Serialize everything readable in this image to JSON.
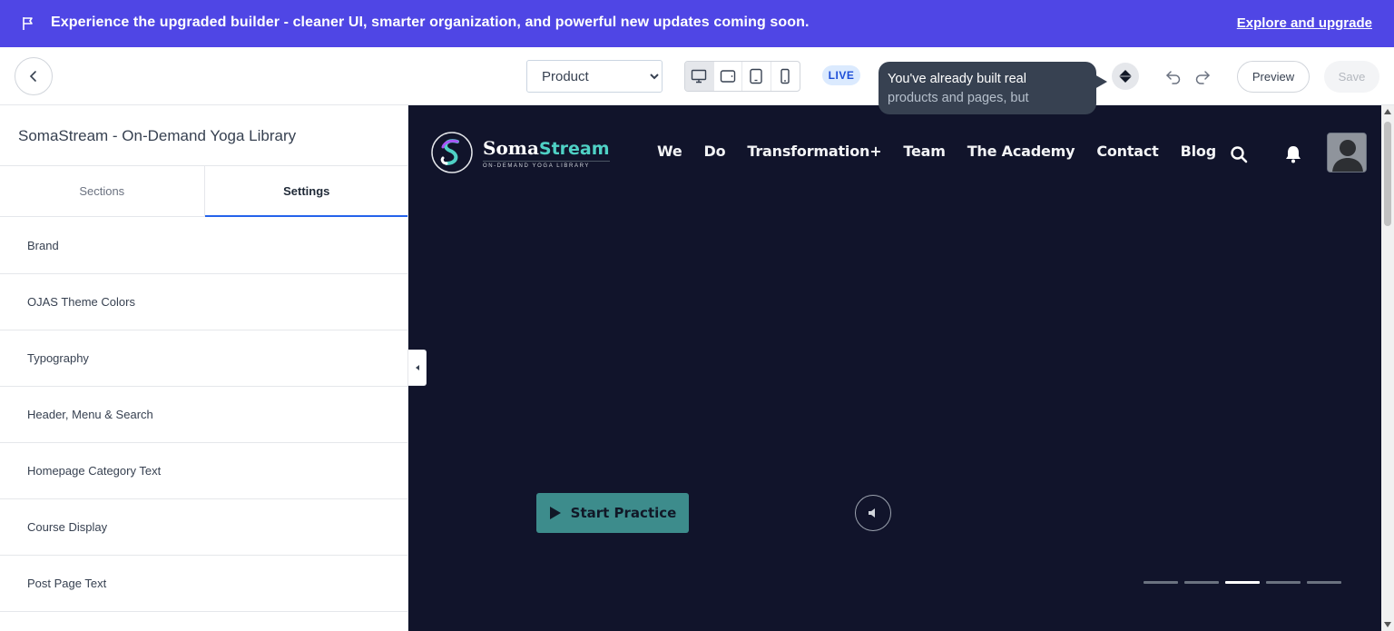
{
  "banner": {
    "message": "Experience the upgraded builder - cleaner UI, smarter organization, and powerful new updates coming soon.",
    "link": "Explore and upgrade"
  },
  "toolbar": {
    "page_select": {
      "selected": "Product",
      "options": [
        "Product"
      ]
    },
    "devices": [
      "desktop-icon",
      "tablet-landscape-icon",
      "tablet-portrait-icon",
      "mobile-icon"
    ],
    "active_device": "desktop",
    "live_label": "LIVE",
    "tooltip": {
      "line1": "You've already built real",
      "line2": "products and pages, but"
    },
    "preview_label": "Preview",
    "save_label": "Save"
  },
  "sidebar": {
    "title": "SomaStream - On-Demand Yoga Library",
    "tabs": [
      {
        "label": "Sections",
        "active": false
      },
      {
        "label": "Settings",
        "active": true
      }
    ],
    "items": [
      {
        "label": "Brand"
      },
      {
        "label": "OJAS Theme Colors"
      },
      {
        "label": "Typography"
      },
      {
        "label": "Header, Menu & Search"
      },
      {
        "label": "Homepage Category Text"
      },
      {
        "label": "Course Display"
      },
      {
        "label": "Post Page Text"
      }
    ]
  },
  "site": {
    "logo_part1": "Soma",
    "logo_part2": "Stream",
    "logo_tagline": "ON-DEMAND YOGA LIBRARY",
    "nav": [
      "We",
      "Do",
      "Transformation+",
      "Team",
      "The Academy",
      "Contact",
      "Blog"
    ],
    "cta": "Start Practice",
    "slider": {
      "count": 5,
      "active_index": 2
    }
  },
  "colors": {
    "banner": "#4f46e5",
    "canvas_bg": "#11142b",
    "accent_teal": "#3d8c8c",
    "tab_underline": "#2563eb"
  }
}
